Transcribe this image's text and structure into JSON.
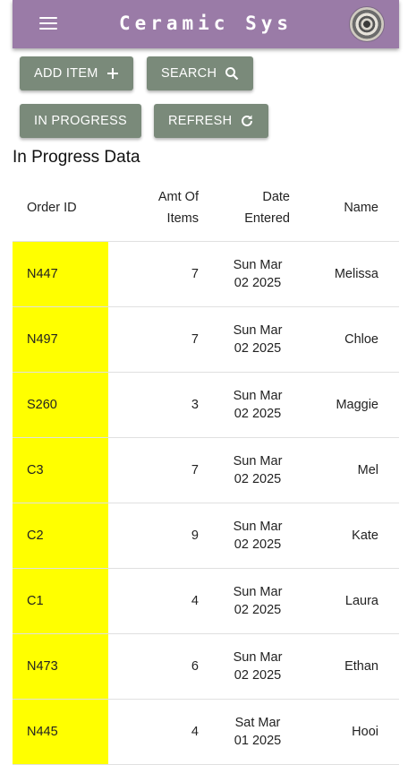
{
  "app": {
    "title": "Ceramic Sys",
    "colors": {
      "appbar": "#9a7ba7",
      "button": "#7a8a7a",
      "highlight": "#ffff00"
    }
  },
  "toolbar": {
    "add_item": "ADD ITEM",
    "search": "SEARCH",
    "in_progress": "IN PROGRESS",
    "refresh": "REFRESH"
  },
  "section": {
    "title": "In Progress Data"
  },
  "table": {
    "headers": {
      "order_id": "Order ID",
      "amt_line1": "Amt Of",
      "amt_line2": "Items",
      "date_line1": "Date",
      "date_line2": "Entered",
      "name": "Name"
    },
    "rows": [
      {
        "order_id": "N447",
        "amt": "7",
        "date1": "Sun Mar",
        "date2": "02 2025",
        "name": "Melissa"
      },
      {
        "order_id": "N497",
        "amt": "7",
        "date1": "Sun Mar",
        "date2": "02 2025",
        "name": "Chloe"
      },
      {
        "order_id": "S260",
        "amt": "3",
        "date1": "Sun Mar",
        "date2": "02 2025",
        "name": "Maggie"
      },
      {
        "order_id": "C3",
        "amt": "7",
        "date1": "Sun Mar",
        "date2": "02 2025",
        "name": "Mel"
      },
      {
        "order_id": "C2",
        "amt": "9",
        "date1": "Sun Mar",
        "date2": "02 2025",
        "name": "Kate"
      },
      {
        "order_id": "C1",
        "amt": "4",
        "date1": "Sun Mar",
        "date2": "02 2025",
        "name": "Laura"
      },
      {
        "order_id": "N473",
        "amt": "6",
        "date1": "Sun Mar",
        "date2": "02 2025",
        "name": "Ethan"
      },
      {
        "order_id": "N445",
        "amt": "4",
        "date1": "Sat Mar",
        "date2": "01 2025",
        "name": "Hooi"
      }
    ]
  }
}
